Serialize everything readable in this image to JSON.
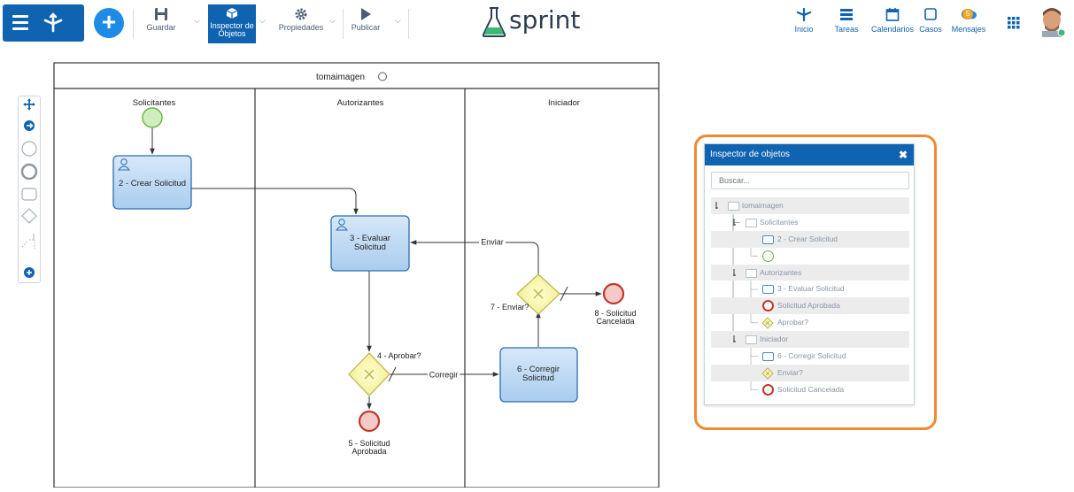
{
  "toolbar": {
    "guardar": "Guardar",
    "inspector_line1": "Inspector de",
    "inspector_line2": "Objetos",
    "propiedades": "Propiedades",
    "publicar": "Publicar"
  },
  "brand": {
    "name": "sprint"
  },
  "nav": {
    "inicio": "Inicio",
    "tareas": "Tareas",
    "calendarios": "Calendarios",
    "casos": "Casos",
    "mensajes": "Mensajes",
    "mensajes_badge": "5"
  },
  "diagram": {
    "pool_title": "tomaimagen",
    "lanes": [
      "Solicitantes",
      "Autorizantes",
      "Iniciador"
    ],
    "task_crear": "2 - Crear Solicitud",
    "task_evaluar_1": "3 - Evaluar",
    "task_evaluar_2": "Solicitud",
    "task_corregir_1": "6 - Corregir",
    "task_corregir_2": "Solicitud",
    "gateway_aprobar": "4 - Aprobar?",
    "gateway_enviar": "7 - Enviar?",
    "flow_corregir": "Corregir",
    "flow_enviar": "Enviar",
    "end_aprobada_1": "5 - Solicitud",
    "end_aprobada_2": "Aprobada",
    "end_cancelada_1": "8 - Solicitud",
    "end_cancelada_2": "Cancelada"
  },
  "inspector": {
    "title": "Inspector de objetos",
    "search_placeholder": "Buscar...",
    "tree": [
      {
        "label": "tomaimagen",
        "kind": "pool"
      },
      {
        "label": "Solicitantes",
        "kind": "lane"
      },
      {
        "label": "2 - Crear Solicitud",
        "kind": "task"
      },
      {
        "label": "",
        "kind": "start"
      },
      {
        "label": "Autorizantes",
        "kind": "lane"
      },
      {
        "label": "3 - Evaluar Solicitud",
        "kind": "task"
      },
      {
        "label": "Solicitud Aprobada",
        "kind": "end"
      },
      {
        "label": "Aprobar?",
        "kind": "gateway"
      },
      {
        "label": "Iniciador",
        "kind": "lane"
      },
      {
        "label": "6 - Corregir Solicitud",
        "kind": "task"
      },
      {
        "label": "Enviar?",
        "kind": "gateway"
      },
      {
        "label": "Solicitud Cancelada",
        "kind": "end"
      }
    ]
  }
}
